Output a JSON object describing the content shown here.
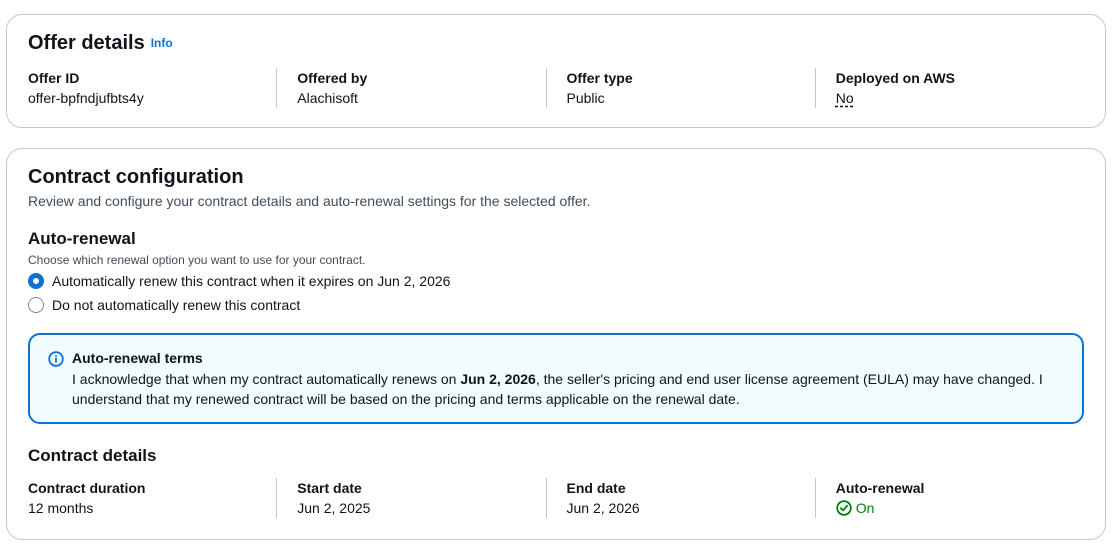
{
  "offer": {
    "title": "Offer details",
    "info_link": "Info",
    "fields": [
      {
        "label": "Offer ID",
        "value": "offer-bpfndjufbts4y"
      },
      {
        "label": "Offered by",
        "value": "Alachisoft"
      },
      {
        "label": "Offer type",
        "value": "Public"
      },
      {
        "label": "Deployed on AWS",
        "value": "No"
      }
    ]
  },
  "contract": {
    "title": "Contract configuration",
    "description": "Review and configure your contract details and auto-renewal settings for the selected offer.",
    "auto_renewal": {
      "title": "Auto-renewal",
      "description": "Choose which renewal option you want to use for your contract.",
      "options": [
        {
          "label": "Automatically renew this contract when it expires on Jun 2, 2026",
          "selected": true
        },
        {
          "label": "Do not automatically renew this contract",
          "selected": false
        }
      ]
    },
    "alert": {
      "icon": "info-circle-icon",
      "title": "Auto-renewal terms",
      "text_before": "I acknowledge that when my contract automatically renews on ",
      "text_bold": "Jun 2, 2026",
      "text_after": ", the seller's pricing and end user license agreement (EULA) may have changed. I understand that my renewed contract will be based on the pricing and terms applicable on the renewal date."
    },
    "details": {
      "title": "Contract details",
      "fields": [
        {
          "label": "Contract duration",
          "value": "12 months"
        },
        {
          "label": "Start date",
          "value": "Jun 2, 2025"
        },
        {
          "label": "End date",
          "value": "Jun 2, 2026"
        },
        {
          "label": "Auto-renewal",
          "value": "On",
          "icon": "check-circle-icon",
          "color": "#037f0c"
        }
      ]
    }
  },
  "colors": {
    "accent": "#0972d3",
    "success": "#037f0c",
    "alert_bg": "#f2fcfd",
    "border": "#c6c6cd"
  }
}
